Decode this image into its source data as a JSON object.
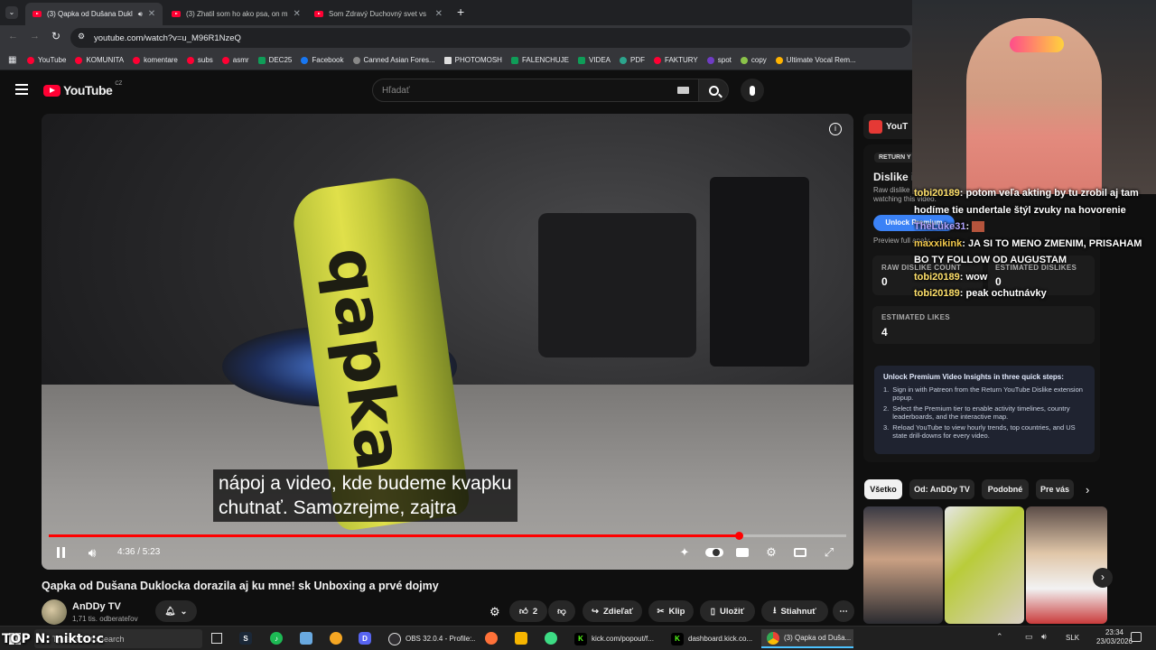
{
  "browser": {
    "tabs": [
      {
        "label": "(3) Qapka od Dušana Dukl",
        "active": true
      },
      {
        "label": "(3) Zhatil som ho ako psa, on m",
        "active": false
      },
      {
        "label": "Som Zdravý Duchovný svet vs",
        "active": false
      }
    ],
    "new_tab": "+",
    "url": "youtube.com/watch?v=u_M96R1NzeQ",
    "bookmarks": [
      {
        "label": "YouTube",
        "color": "#ff0033"
      },
      {
        "label": "KOMUNITA",
        "color": "#ff0033"
      },
      {
        "label": "komentare",
        "color": "#ff0033"
      },
      {
        "label": "subs",
        "color": "#ff0033"
      },
      {
        "label": "asmr",
        "color": "#ff0033"
      },
      {
        "label": "DEC25",
        "color": "#0f9d58"
      },
      {
        "label": "Facebook",
        "color": "#1877f2"
      },
      {
        "label": "Canned Asian Fores...",
        "color": "#888888"
      },
      {
        "label": "PHOTOMOSH",
        "color": "#dddddd"
      },
      {
        "label": "FALENCHUJE",
        "color": "#0f9d58"
      },
      {
        "label": "VIDEA",
        "color": "#0f9d58"
      },
      {
        "label": "PDF",
        "color": "#2ca58d"
      },
      {
        "label": "FAKTURY",
        "color": "#ff0033"
      },
      {
        "label": "spot",
        "color": "#6f3cc4"
      },
      {
        "label": "copy",
        "color": "#8bc34a"
      },
      {
        "label": "Ultimate Vocal Rem...",
        "color": "#ffb300"
      }
    ]
  },
  "youtube": {
    "logo_text": "YouTube",
    "region": "CZ",
    "search_placeholder": "Hľadať",
    "subtitle_line1": "nápoj a video, kde budeme kvapku",
    "subtitle_line2": "chutnať. Samozrejme, zajtra",
    "can_text": "qapka",
    "time": "4:36 / 5:23",
    "progress_fraction": 0.865,
    "title": "Qapka od Dušana Duklocka dorazila aj ku mne! sk Unboxing a prvé dojmy",
    "channel": "AnDDy TV",
    "subscribers": "1,71 tis. odberateľov",
    "likes": "2",
    "actions": {
      "share": "Zdieľať",
      "clip": "Klip",
      "save": "Uložiť",
      "download": "Stiahnuť"
    }
  },
  "sidebar": {
    "header_text": "YouT",
    "badge": "RETURN Y",
    "card_title": "Dislike i",
    "card_desc_1": "Raw dislike",
    "card_desc_2": "watching this video.",
    "unlock_btn": "Unlock Premium",
    "preview_text": "Preview full analy",
    "raw_dislike_label": "RAW DISLIKE COUNT",
    "raw_dislike_value": "0",
    "est_dislike_label": "ESTIMATED DISLIKES",
    "est_dislike_value": "0",
    "est_likes_label": "ESTIMATED LIKES",
    "est_likes_value": "4",
    "insights_title": "Unlock Premium Video Insights in three quick steps:",
    "insights_steps": [
      "Sign in with Patreon from the Return YouTube Dislike extension popup.",
      "Select the Premium tier to enable activity timelines, country leaderboards, and the interactive map.",
      "Reload YouTube to view hourly trends, top countries, and US state drill-downs for every video."
    ],
    "chips": [
      "Všetko",
      "Od: AnDDy TV",
      "Podobné",
      "Pre vás"
    ]
  },
  "stream_overlay": {
    "chat": [
      {
        "user": "tobi20189",
        "msg": "potom veľa akting by tu zrobil aj tam hodíme tie undertale štýl zvuky na hovorenie"
      },
      {
        "user": "TheLuke31",
        "msg": ""
      },
      {
        "user": "maxxikink",
        "msg": "JA SI TO MENO ZMENIM, PRISAHAM BO TY FOLLOW OD AUGUSTAM"
      },
      {
        "user": "tobi20189",
        "msg": "wow"
      },
      {
        "user": "tobi20189",
        "msg": "peak ochutnávky"
      }
    ],
    "topn": "TOP N: nikto:c"
  },
  "taskbar": {
    "search": "Type here to search",
    "apps": [
      {
        "label": "OBS 32.0.4 - Profile:...",
        "color": "#302e31"
      },
      {
        "label": "kick.com/popout/f...",
        "color": "#53fc18"
      },
      {
        "label": "dashboard.kick.co...",
        "color": "#53fc18"
      },
      {
        "label": "(3) Qapka od Duša...",
        "color": "#4285f4"
      }
    ],
    "lang": "SLK",
    "time": "23:34",
    "date": "23/03/2026"
  }
}
